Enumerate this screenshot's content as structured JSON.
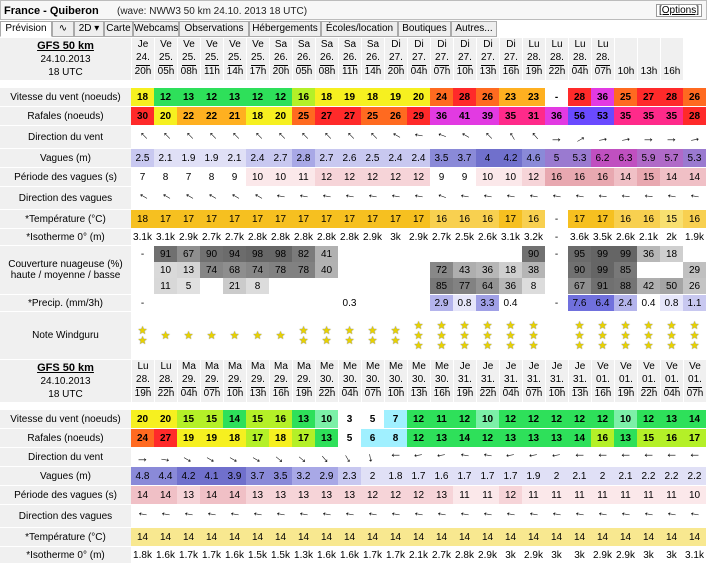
{
  "header": {
    "title": "France - Quiberon",
    "subtitle": "(wave: NWW3 50 km 24.10. 2013 18 UTC)",
    "options": "[Options]"
  },
  "tabs": [
    "Prévision",
    "∿",
    "2D ▾",
    "Carte",
    "Webcams",
    "Observations",
    "Hébergements",
    "Écoles/location",
    "Boutiques",
    "Autres..."
  ],
  "labels": {
    "model": "GFS 50 km",
    "date": "24.10.2013",
    "utc": "18 UTC",
    "wind": "Vitesse du vent (noeuds)",
    "gust": "Rafales (noeuds)",
    "wind_dir": "Direction du vent",
    "waves": "Vagues (m)",
    "period": "Période des vagues (s)",
    "wave_dir": "Direction des vagues",
    "temp": "*Température (°C)",
    "iso": "*Isotherme 0° (m)",
    "cloud": "Couverture nuageuse (%) haute / moyenne / basse",
    "precip": "*Precip. (mm/3h)",
    "rating": "Note Windguru"
  },
  "block1": {
    "days": [
      "Je",
      "Ve",
      "Ve",
      "Ve",
      "Ve",
      "Ve",
      "Sa",
      "Sa",
      "Sa",
      "Sa",
      "Sa",
      "Di",
      "Di",
      "Di",
      "Di",
      "Di",
      "Di",
      "Lu",
      "Lu",
      "Lu",
      "Lu"
    ],
    "dates": [
      "24.",
      "25.",
      "25.",
      "25.",
      "25.",
      "25.",
      "26.",
      "26.",
      "26.",
      "26.",
      "26.",
      "27.",
      "27.",
      "27.",
      "27.",
      "27.",
      "27.",
      "28.",
      "28.",
      "28.",
      "28."
    ],
    "hours": [
      "20h",
      "05h",
      "08h",
      "11h",
      "14h",
      "17h",
      "20h",
      "05h",
      "08h",
      "11h",
      "14h",
      "20h",
      "04h",
      "07h",
      "10h",
      "13h",
      "16h",
      "19h",
      "22h",
      "04h",
      "07h",
      "10h",
      "13h",
      "16h"
    ],
    "wind": [
      "18",
      "12",
      "13",
      "12",
      "13",
      "12",
      "12",
      "16",
      "18",
      "19",
      "18",
      "19",
      "20",
      "24",
      "28",
      "26",
      "23",
      "23",
      "-",
      "28",
      "36",
      "25",
      "27",
      "28",
      "26"
    ],
    "gust": [
      "30",
      "20",
      "22",
      "22",
      "21",
      "18",
      "20",
      "25",
      "27",
      "27",
      "25",
      "26",
      "29",
      "36",
      "41",
      "39",
      "35",
      "31",
      "36",
      "56",
      "53",
      "35",
      "35",
      "35",
      "28"
    ],
    "waves": [
      "2.5",
      "2.1",
      "1.9",
      "1.9",
      "2.1",
      "2.4",
      "2.7",
      "2.8",
      "2.7",
      "2.6",
      "2.5",
      "2.4",
      "2.4",
      "3.5",
      "3.7",
      "4",
      "4.2",
      "4.6",
      "5",
      "5.3",
      "6.2",
      "6.3",
      "5.9",
      "5.7",
      "5.3"
    ],
    "period": [
      "7",
      "8",
      "7",
      "8",
      "9",
      "10",
      "10",
      "11",
      "12",
      "12",
      "12",
      "12",
      "12",
      "9",
      "9",
      "10",
      "10",
      "12",
      "16",
      "16",
      "16",
      "14",
      "15",
      "14",
      "14"
    ],
    "temp": [
      "18",
      "17",
      "17",
      "17",
      "17",
      "17",
      "17",
      "17",
      "17",
      "17",
      "17",
      "17",
      "17",
      "16",
      "16",
      "16",
      "17",
      "16",
      "-",
      "17",
      "17",
      "16",
      "16",
      "15",
      "16"
    ],
    "iso": [
      "3.1k",
      "3.1k",
      "2.9k",
      "2.7k",
      "2.7k",
      "2.8k",
      "2.8k",
      "2.8k",
      "2.8k",
      "2.8k",
      "2.9k",
      "3k",
      "2.9k",
      "2.7k",
      "2.5k",
      "2.6k",
      "3.1k",
      "3.2k",
      "-",
      "3.6k",
      "3.5k",
      "2.6k",
      "2.1k",
      "2k",
      "1.9k"
    ],
    "cloud_h": [
      "-",
      "91",
      "67",
      "90",
      "94",
      "98",
      "98",
      "82",
      "41",
      "",
      "",
      "",
      "",
      "",
      "",
      "",
      "",
      "90",
      "-",
      "95",
      "99",
      "99",
      "36",
      "18",
      ""
    ],
    "cloud_m": [
      "",
      "10",
      "13",
      "74",
      "68",
      "74",
      "78",
      "78",
      "40",
      "",
      "",
      "",
      "",
      "72",
      "43",
      "36",
      "18",
      "38",
      "",
      "90",
      "99",
      "85",
      "",
      "",
      "29"
    ],
    "cloud_l": [
      "",
      "11",
      "5",
      "",
      "21",
      "8",
      "",
      "",
      "",
      "",
      "",
      "",
      "",
      "85",
      "77",
      "64",
      "36",
      "8",
      "",
      "67",
      "91",
      "88",
      "42",
      "50",
      "26"
    ],
    "precip": [
      "-",
      "",
      "",
      "",
      "",
      "",
      "",
      "",
      "",
      "0.3",
      "",
      "",
      "",
      "2.9",
      "0.8",
      "3.3",
      "0.4",
      "",
      "-",
      "7.6",
      "6.4",
      "2.4",
      "0.4",
      "0.8",
      "1.1"
    ],
    "stars": [
      2,
      1,
      1,
      1,
      1,
      1,
      1,
      2,
      2,
      2,
      2,
      2,
      3,
      3,
      3,
      3,
      3,
      3,
      0,
      3,
      3,
      3,
      3,
      3,
      3
    ]
  },
  "block2": {
    "days": [
      "Lu",
      "Lu",
      "Ma",
      "Ma",
      "Ma",
      "Ma",
      "Ma",
      "Ma",
      "Me",
      "Me",
      "Me",
      "Me",
      "Me",
      "Me",
      "Je",
      "Je",
      "Je",
      "Je",
      "Je",
      "Je",
      "Ve",
      "Ve",
      "Ve",
      "Ve",
      "Ve"
    ],
    "dates": [
      "28.",
      "28.",
      "29.",
      "29.",
      "29.",
      "29.",
      "29.",
      "29.",
      "30.",
      "30.",
      "30.",
      "30.",
      "30.",
      "30.",
      "31.",
      "31.",
      "31.",
      "31.",
      "31.",
      "31.",
      "01.",
      "01.",
      "01.",
      "01.",
      "01."
    ],
    "hours": [
      "19h",
      "22h",
      "04h",
      "07h",
      "10h",
      "13h",
      "16h",
      "19h",
      "22h",
      "04h",
      "07h",
      "10h",
      "13h",
      "16h",
      "19h",
      "22h",
      "04h",
      "07h",
      "10h",
      "13h",
      "16h",
      "19h",
      "22h",
      "04h",
      "07h"
    ],
    "wind": [
      "20",
      "20",
      "15",
      "15",
      "14",
      "15",
      "16",
      "13",
      "10",
      "3",
      "5",
      "7",
      "12",
      "11",
      "12",
      "10",
      "12",
      "12",
      "12",
      "12",
      "12",
      "10",
      "12",
      "13",
      "14"
    ],
    "gust": [
      "24",
      "27",
      "19",
      "19",
      "18",
      "17",
      "18",
      "17",
      "13",
      "5",
      "6",
      "8",
      "12",
      "13",
      "14",
      "12",
      "13",
      "13",
      "13",
      "14",
      "16",
      "13",
      "15",
      "16",
      "17"
    ],
    "waves": [
      "4.8",
      "4.4",
      "4.2",
      "4.1",
      "3.9",
      "3.7",
      "3.5",
      "3.2",
      "2.9",
      "2.3",
      "2",
      "1.8",
      "1.7",
      "1.6",
      "1.7",
      "1.7",
      "1.7",
      "1.9",
      "2",
      "2.1",
      "2",
      "2.1",
      "2.2",
      "2.2",
      "2.2"
    ],
    "period": [
      "14",
      "14",
      "13",
      "14",
      "14",
      "13",
      "13",
      "13",
      "13",
      "13",
      "12",
      "12",
      "12",
      "13",
      "11",
      "11",
      "12",
      "11",
      "11",
      "11",
      "11",
      "11",
      "11",
      "11",
      "10"
    ],
    "temp": [
      "14",
      "14",
      "14",
      "14",
      "14",
      "14",
      "14",
      "14",
      "14",
      "14",
      "14",
      "14",
      "14",
      "14",
      "14",
      "14",
      "14",
      "14",
      "14",
      "14",
      "14",
      "14",
      "14",
      "14",
      "14"
    ],
    "iso": [
      "1.8k",
      "1.6k",
      "1.7k",
      "1.7k",
      "1.6k",
      "1.5k",
      "1.5k",
      "1.3k",
      "1.6k",
      "1.6k",
      "1.7k",
      "1.7k",
      "2.1k",
      "2.7k",
      "2.8k",
      "2.9k",
      "3k",
      "2.9k",
      "3k",
      "3k",
      "2.9k",
      "2.9k",
      "3k",
      "3k",
      "3.1k"
    ]
  },
  "colors": {
    "label_bg": "#f0f0f0",
    "star": "#e8d200"
  }
}
